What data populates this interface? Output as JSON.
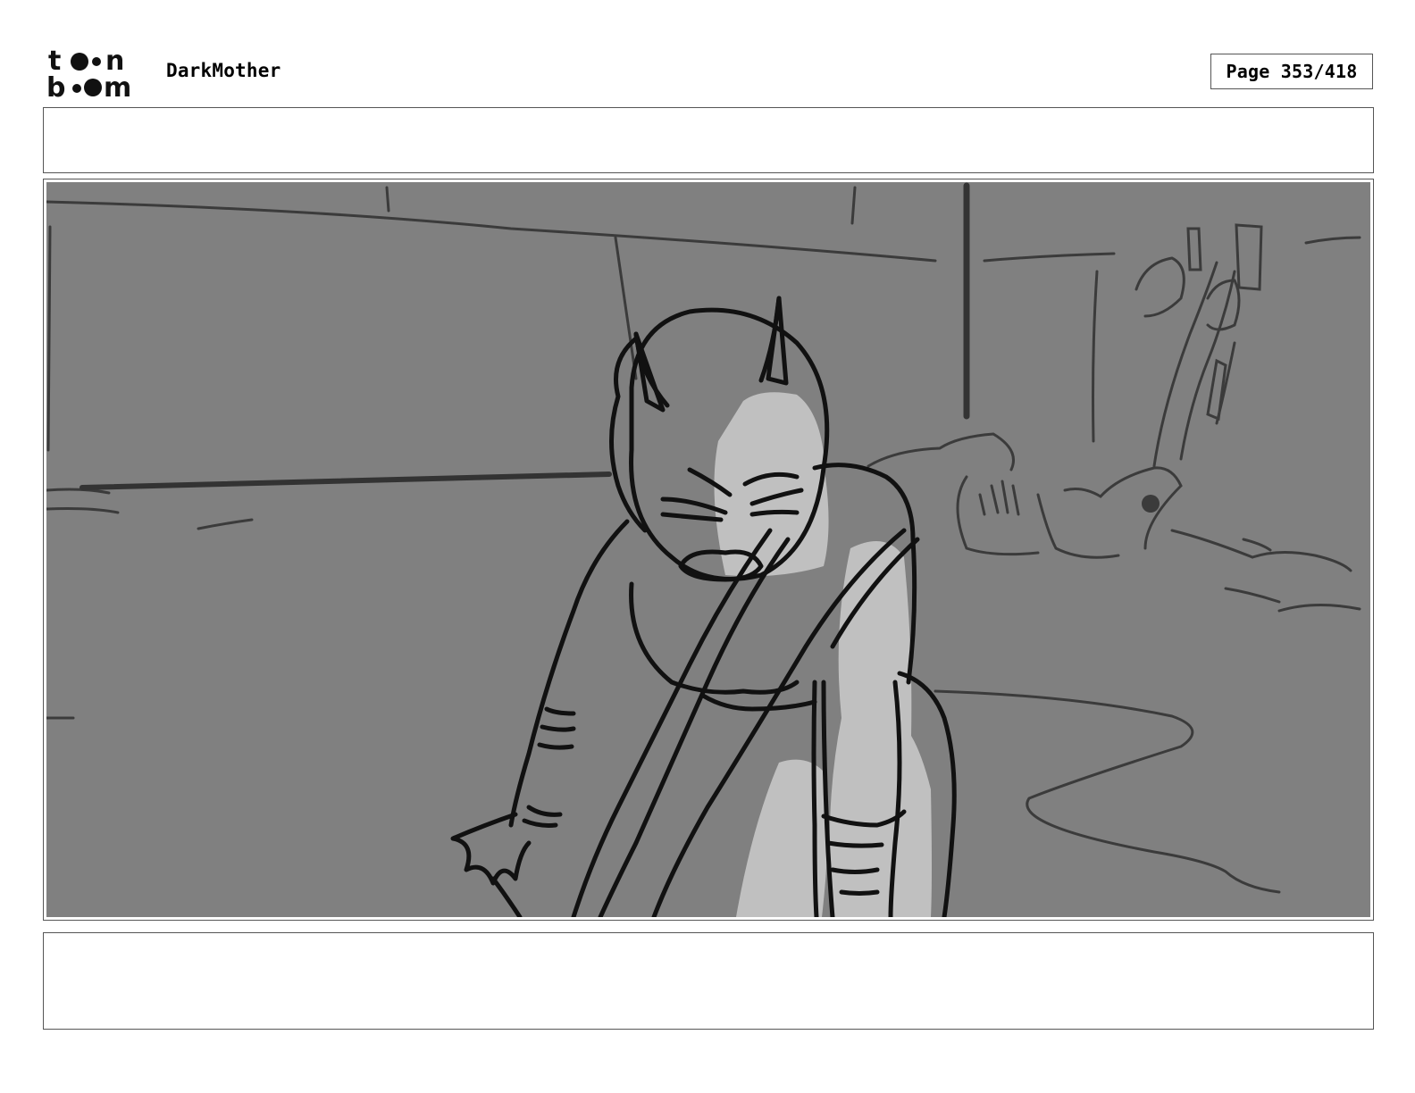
{
  "logo": {
    "text_line_1": "to•n",
    "text_line_2": "b•••m",
    "icon": "toon-boom-logo"
  },
  "header": {
    "project_title": "DarkMother",
    "page_label": "Page 353/418"
  },
  "panel": {
    "action_notes": "",
    "dialogue_notes": "",
    "artwork": "storyboard-sketch"
  },
  "colors": {
    "background": "#ffffff",
    "frame_gray": "#808080",
    "highlight_gray": "#c0c0c0",
    "line_dark": "#111111",
    "line_mid": "#3b3b3b"
  }
}
